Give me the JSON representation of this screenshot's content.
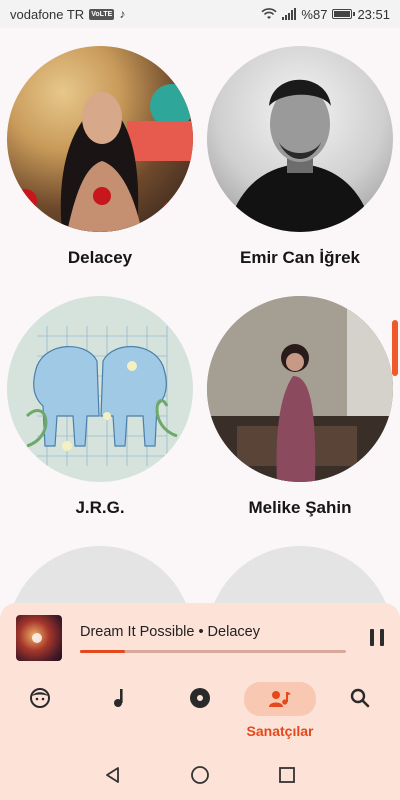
{
  "status_bar": {
    "carrier": "vodafone TR",
    "volte_badge": "VoLTE",
    "battery": "%87",
    "time": "23:51"
  },
  "artists": [
    {
      "name": "Delacey",
      "avatar": "delacey"
    },
    {
      "name": "Emir Can İğrek",
      "avatar": "emir"
    },
    {
      "name": "J.R.G.",
      "avatar": "jrg"
    },
    {
      "name": "Melike Şahin",
      "avatar": "melike"
    }
  ],
  "mini_player": {
    "track": "Dream It Possible • Delacey",
    "progress_fraction": 0.17
  },
  "bottom_nav": {
    "items": [
      {
        "icon": "face-icon"
      },
      {
        "icon": "music-note-icon"
      },
      {
        "icon": "album-icon"
      },
      {
        "icon": "artist-icon",
        "label": "Sanatçılar",
        "active": true
      },
      {
        "icon": "search-icon"
      }
    ]
  },
  "colors": {
    "accent": "#e4481b",
    "player_bg": "#fde2d8",
    "active_pill": "#f9c8b3"
  }
}
